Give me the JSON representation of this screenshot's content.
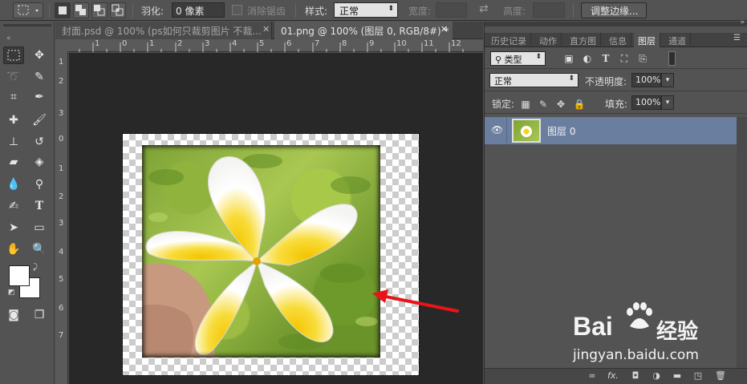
{
  "options_bar": {
    "feather_label": "羽化:",
    "feather_value": "0 像素",
    "antialias_label": "消除锯齿",
    "style_label": "样式:",
    "style_value": "正常",
    "width_label": "宽度:",
    "height_label": "高度:",
    "refine_edge_label": "调整边缘..."
  },
  "document_tabs": [
    {
      "label": "封面.psd @ 100% (ps如何只裁剪图片 不裁...",
      "active": false
    },
    {
      "label": "01.png @ 100% (图层 0, RGB/8#) *",
      "active": true
    }
  ],
  "rulers": {
    "top": [
      "1",
      "0",
      "1",
      "2",
      "3",
      "4",
      "5",
      "6",
      "7",
      "8",
      "9",
      "10",
      "11",
      "12"
    ],
    "left": [
      "1",
      "2",
      "3",
      "0",
      "1",
      "2",
      "3",
      "4",
      "5",
      "6",
      "7"
    ]
  },
  "panel_tabs": [
    "历史记录",
    "动作",
    "直方图",
    "信息",
    "图层",
    "通道"
  ],
  "layers_panel": {
    "filter_kind": "类型",
    "blend_mode": "正常",
    "opacity_label": "不透明度:",
    "opacity_value": "100%",
    "lock_label": "锁定:",
    "fill_label": "填充:",
    "fill_value": "100%",
    "layers": [
      {
        "name": "图层 0",
        "visible": true,
        "selected": true
      }
    ]
  },
  "panel_bottom": {
    "fx_label": "fx."
  },
  "watermark": {
    "brand": "Bai",
    "brand_cn": "经验",
    "url": "jingyan.baidu.com"
  },
  "colors": {
    "ui_gray": "#535353",
    "canvas_bg": "#282828",
    "selected_layer": "#6a7ea0",
    "annotation_arrow": "#e8141a"
  }
}
